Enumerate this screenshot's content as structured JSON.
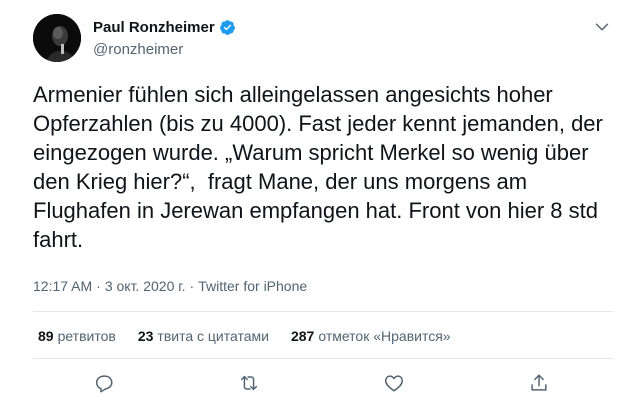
{
  "author": {
    "display_name": "Paul Ronzheimer",
    "handle": "@ronzheimer",
    "verified": true,
    "avatar_icon": "person-avatar"
  },
  "tweet": {
    "text": "Armenier fühlen sich alleingelassen angesichts hoher Opferzahlen (bis zu 4000). Fast jeder kennt jemanden, der eingezogen wurde. „Warum spricht Merkel so wenig über den Krieg hier?“,  fragt Mane, der uns morgens am Flughafen in Jerewan empfangen hat. Front von hier 8 std fahrt.",
    "time": "12:17 AM",
    "date": "3 окт. 2020 г.",
    "source": "Twitter for iPhone"
  },
  "stats": {
    "retweets_count": "89",
    "retweets_label": "ретвитов",
    "quotes_count": "23",
    "quotes_label": "твита с цитатами",
    "likes_count": "287",
    "likes_label": "отметок «Нравится»"
  },
  "colors": {
    "accent": "#1d9bf0",
    "text": "#0f1419",
    "secondary": "#536471",
    "divider": "#e1e8ed"
  },
  "actions": [
    "reply-icon",
    "retweet-icon",
    "like-icon",
    "share-icon"
  ]
}
